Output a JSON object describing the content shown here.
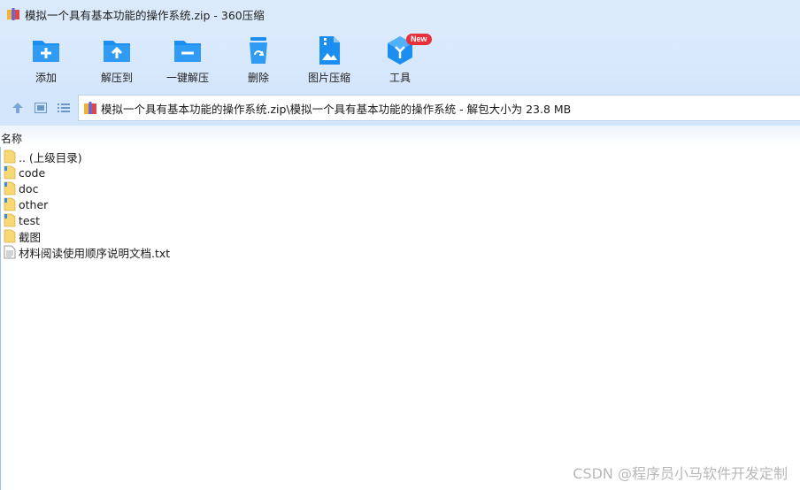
{
  "window": {
    "title": "模拟一个具有基本功能的操作系统.zip - 360压缩"
  },
  "toolbar": {
    "buttons": [
      {
        "label": "添加",
        "icon": "add-folder-icon"
      },
      {
        "label": "解压到",
        "icon": "extract-to-icon"
      },
      {
        "label": "一键解压",
        "icon": "one-click-extract-icon"
      },
      {
        "label": "删除",
        "icon": "recycle-bin-icon"
      },
      {
        "label": "图片压缩",
        "icon": "image-compress-icon"
      },
      {
        "label": "工具",
        "icon": "tools-cube-icon",
        "badge": "New"
      }
    ]
  },
  "navigation": {
    "up_icon": "arrow-up-icon",
    "view_icon": "thumbnail-view-icon",
    "list_icon": "list-view-icon",
    "address": "模拟一个具有基本功能的操作系统.zip\\模拟一个具有基本功能的操作系统 - 解包大小为 23.8 MB"
  },
  "list": {
    "column_name": "名称",
    "items": [
      {
        "name": ".. (上级目录)",
        "type": "parent-folder"
      },
      {
        "name": "code",
        "type": "folder"
      },
      {
        "name": "doc",
        "type": "folder"
      },
      {
        "name": "other",
        "type": "folder"
      },
      {
        "name": "test",
        "type": "folder"
      },
      {
        "name": "截图",
        "type": "folder"
      },
      {
        "name": "材料阅读使用顺序说明文档.txt",
        "type": "text-file"
      }
    ]
  },
  "watermark": "CSDN @程序员小马软件开发定制",
  "colors": {
    "accent_blue": "#1c8ef0",
    "toolbar_bg": "#d4e6fb",
    "folder_yellow": "#f8d775",
    "badge_red": "#e8303a"
  }
}
